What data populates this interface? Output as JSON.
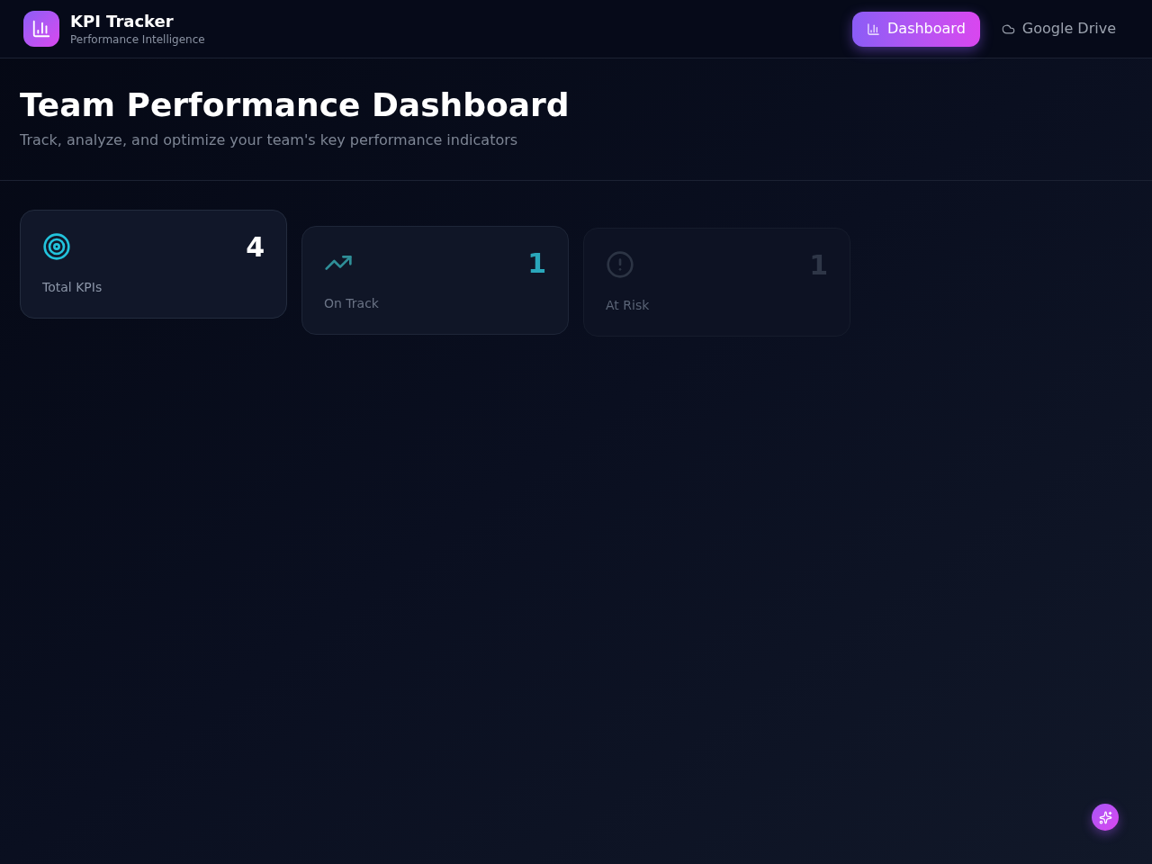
{
  "header": {
    "app_name": "KPI Tracker",
    "tagline": "Performance Intelligence"
  },
  "nav": [
    {
      "label": "Dashboard",
      "kind": "chart",
      "selected": true
    },
    {
      "label": "Google Drive",
      "kind": "cloud",
      "selected": false
    }
  ],
  "hero": {
    "title": "Team Performance Dashboard",
    "subtitle": "Track, analyze, and optimize your team's key performance indicators"
  },
  "stats": [
    {
      "label": "Total KPIs",
      "value": "4",
      "kind": "target",
      "color": "#22c3dc"
    },
    {
      "label": "On Track",
      "value": "1",
      "kind": "trend",
      "color": "#2f8f98"
    },
    {
      "label": "At Risk",
      "value": "1",
      "kind": "alert",
      "color": "#2c3444"
    }
  ]
}
